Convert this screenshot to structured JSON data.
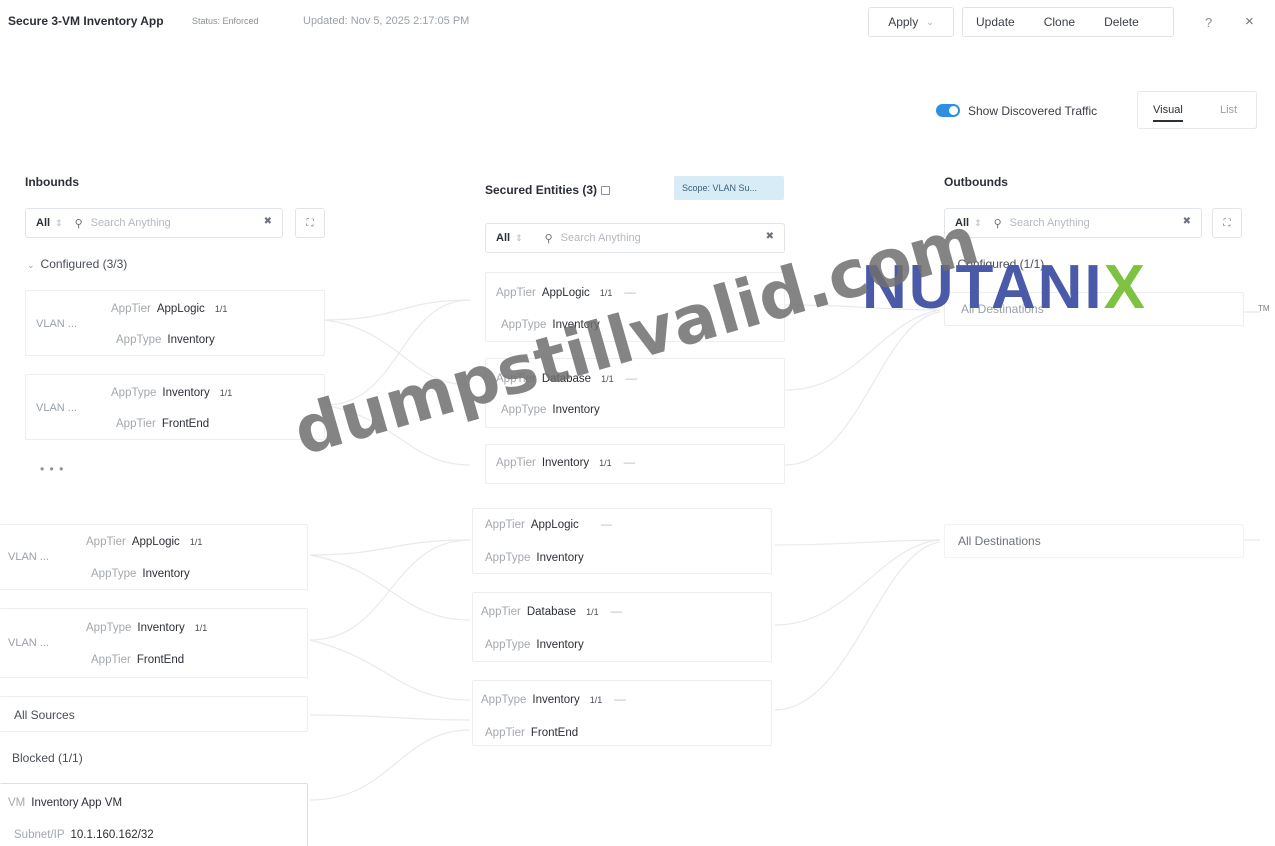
{
  "header": {
    "title": "Secure 3-VM Inventory App",
    "status": "Status: Enforced",
    "updated": "Updated: Nov 5, 2025 2:17:05 PM",
    "apply_label": "Apply",
    "update_label": "Update",
    "clone_label": "Clone",
    "delete_label": "Delete",
    "help_label": "?",
    "close_label": "×"
  },
  "toolbar": {
    "show_discovered_label": "Show Discovered Traffic",
    "show_discovered_on": true,
    "view_visual": "Visual",
    "view_list": "List",
    "toggle_color": "#2f8fe0"
  },
  "inbounds": {
    "title": "Inbounds",
    "filter": "All",
    "search_placeholder": "Search Anything",
    "configured_label": "Configured (3/3)",
    "cards": [
      {
        "source": "VLAN ...",
        "r1_key": "AppTier",
        "r1_val": "AppLogic",
        "r1_count": "1/1",
        "r2_key": "AppType",
        "r2_val": "Inventory"
      },
      {
        "source": "VLAN ...",
        "r1_key": "AppType",
        "r1_val": "Inventory",
        "r1_count": "1/1",
        "r2_key": "AppTier",
        "r2_val": "FrontEnd"
      },
      {
        "source": "VLAN ...",
        "r1_key": "AppTier",
        "r1_val": "AppLogic",
        "r1_count": "1/1",
        "r2_key": "AppType",
        "r2_val": "Inventory"
      },
      {
        "source": "VLAN ...",
        "r1_key": "AppType",
        "r1_val": "Inventory",
        "r1_count": "1/1",
        "r2_key": "AppTier",
        "r2_val": "FrontEnd"
      }
    ],
    "more": "• • •",
    "all_sources": "All Sources",
    "blocked_label": "Blocked (1/1)",
    "blocked": {
      "k1": "VM",
      "v1": "Inventory App VM",
      "k2": "Subnet/IP",
      "v2": "10.1.160.162/32"
    }
  },
  "secured": {
    "title": "Secured Entities (3)",
    "scope": "Scope: VLAN Su...",
    "filter": "All",
    "search_placeholder": "Search Anything",
    "cards": [
      {
        "r1_key": "AppTier",
        "r1_val": "AppLogic",
        "r1_count": "1/1",
        "r1_dash": "—",
        "r2_key": "AppType",
        "r2_val": "Inventory"
      },
      {
        "r1_key": "AppTier",
        "r1_val": "Database",
        "r1_count": "1/1",
        "r1_dash": "—",
        "r2_key": "AppType",
        "r2_val": "Inventory"
      },
      {
        "r1_key": "AppTier",
        "r1_val": "Inventory",
        "r1_count": "1/1",
        "r1_dash": "—",
        "r2_key": "",
        "r2_val": ""
      },
      {
        "r1_key": "AppTier",
        "r1_val": "AppLogic",
        "r1_count": "",
        "r1_dash": "—",
        "r2_key": "AppType",
        "r2_val": "Inventory"
      },
      {
        "r1_key": "AppTier",
        "r1_val": "Database",
        "r1_count": "1/1",
        "r1_dash": "—",
        "r2_key": "AppType",
        "r2_val": "Inventory"
      },
      {
        "r1_key": "AppType",
        "r1_val": "Inventory",
        "r1_count": "1/1",
        "r1_dash": "—",
        "r2_key": "AppTier",
        "r2_val": "FrontEnd"
      }
    ]
  },
  "outbounds": {
    "title": "Outbounds",
    "filter": "All",
    "search_placeholder": "Search Anything",
    "configured_label": "Configured (1/1)",
    "dest_1": "All Destinations",
    "dest_2": "All Destinations"
  },
  "watermark": {
    "logo_part1": "NUTANI",
    "logo_part2": "X",
    "logo_tm": "TM",
    "text": "dumpstillvalid.com"
  }
}
